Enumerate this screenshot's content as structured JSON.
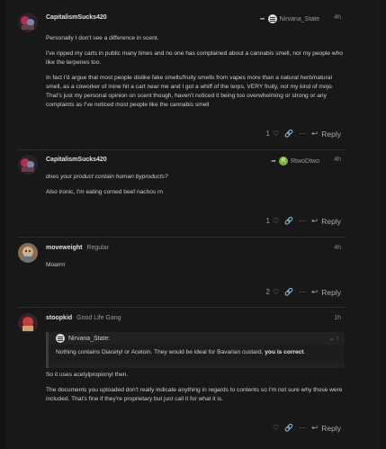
{
  "posts": [
    {
      "author": "CapitalismSucks420",
      "group": "",
      "reply_to": "Nirvana_State",
      "time": "4h",
      "paragraphs": [
        "Personally I don't see a difference in scent.",
        "I've ripped my carts in public many times and no one has complained about a cannabis smell, nor my people who like the terpenes too.",
        "In fact I'd argue that most people dislike fake smells/fruity smells from vapes more than a natural herb/natural smell, as a coworker of mine hit a cart near me and I got a whiff of the terps, VERY fruity, not my kind of mojo. That's just my personal opinion on scent though, haven't noticed it being too overwhelming or strong or any complaints as I've noticed most people like the cannabis smell"
      ],
      "likes": "1",
      "reply_label": "Reply"
    },
    {
      "author": "CapitalismSucks420",
      "group": "",
      "reply_to": "RtwoDtwo",
      "reply_to_initial": "R",
      "time": "4h",
      "paragraphs_italic": "does your product contain human byproducts?",
      "paragraphs": [
        "Also ironic, I'm eating corned beef nachos rn"
      ],
      "likes": "1",
      "reply_label": "Reply"
    },
    {
      "author": "moveweight",
      "group": "Regular",
      "time": "4h",
      "paragraphs": [
        "Moarrrr"
      ],
      "likes": "2",
      "reply_label": "Reply"
    },
    {
      "author": "stoopkid",
      "group": "Good Life Gang",
      "time": "1h",
      "quote_author": "Nirvana_State:",
      "quote_text": "Nothing contains Diacetyl or Acetoin. They would be ideal for Bavarian custard,",
      "quote_bold": "you is correct",
      "quote_end": ".",
      "paragraphs": [
        "So it uses acetylpropionyl then.",
        "The documents you uploaded don't really indicate anything in regards to contents so I'm not sure why those were included. That's fine if they're proprietary but just call it for what it is."
      ],
      "reply_label": "Reply"
    }
  ],
  "colors": {
    "background": "#181818",
    "text": "#cfcfcf",
    "muted": "#9a9a9a",
    "rtwodtwo_avatar": "#7fb04a"
  }
}
